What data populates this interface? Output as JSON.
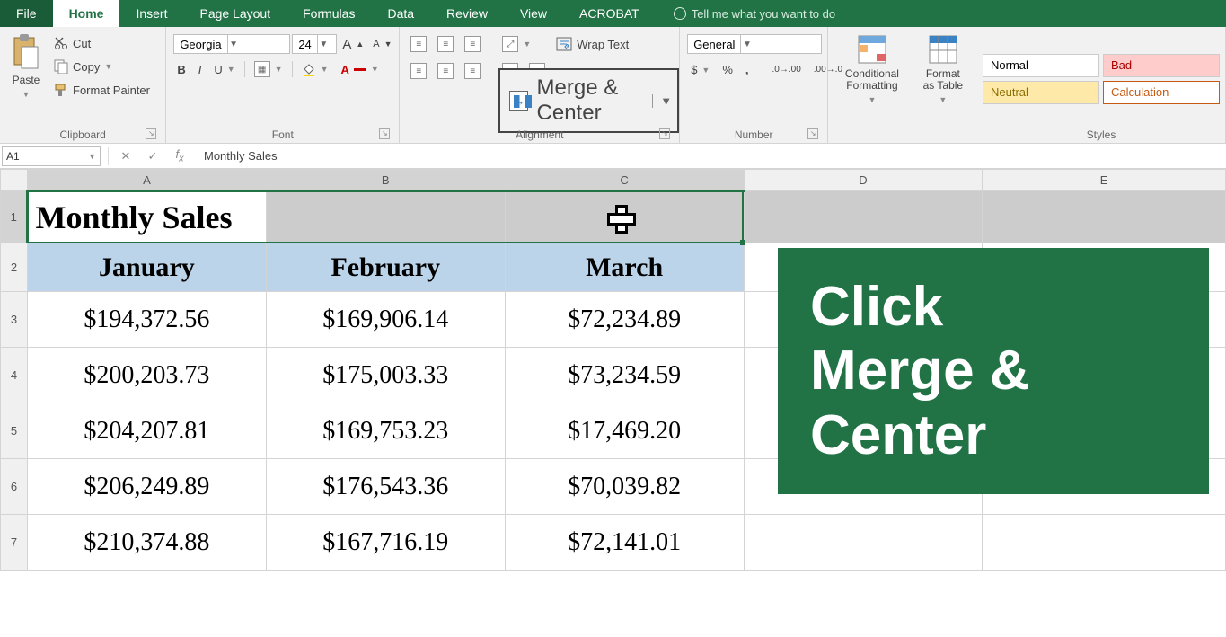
{
  "tabs": {
    "file": "File",
    "home": "Home",
    "insert": "Insert",
    "pagelayout": "Page Layout",
    "formulas": "Formulas",
    "data": "Data",
    "review": "Review",
    "view": "View",
    "acrobat": "ACROBAT",
    "tellme": "Tell me what you want to do"
  },
  "clipboard": {
    "paste": "Paste",
    "cut": "Cut",
    "copy": "Copy",
    "painter": "Format Painter",
    "group": "Clipboard"
  },
  "font": {
    "name": "Georgia",
    "size": "24",
    "bold": "B",
    "italic": "I",
    "underline": "U",
    "group": "Font"
  },
  "alignment": {
    "wrap": "Wrap Text",
    "merge": "Merge & Center",
    "group": "Alignment"
  },
  "number": {
    "format": "General",
    "percent": "%",
    "comma": ",",
    "inc": ".0",
    "dec": ".00",
    "group": "Number"
  },
  "cond": {
    "cond": "Conditional Formatting",
    "tablefmt": "Format as Table"
  },
  "styles": {
    "normal": "Normal",
    "bad": "Bad",
    "neutral": "Neutral",
    "calc": "Calculation",
    "group": "Styles"
  },
  "namebox": "A1",
  "formula": "Monthly Sales",
  "columns": [
    "A",
    "B",
    "C",
    "D",
    "E"
  ],
  "rows": [
    "1",
    "2",
    "3",
    "4",
    "5",
    "6",
    "7"
  ],
  "title": "Monthly Sales",
  "months": [
    "January",
    "February",
    "March"
  ],
  "values": [
    [
      "$194,372.56",
      "$169,906.14",
      "$72,234.89"
    ],
    [
      "$200,203.73",
      "$175,003.33",
      "$73,234.59"
    ],
    [
      "$204,207.81",
      "$169,753.23",
      "$17,469.20"
    ],
    [
      "$206,249.89",
      "$176,543.36",
      "$70,039.82"
    ],
    [
      "$210,374.88",
      "$167,716.19",
      "$72,141.01"
    ]
  ],
  "overlay": {
    "l1": "Click",
    "l2": "Merge &",
    "l3": "Center"
  }
}
